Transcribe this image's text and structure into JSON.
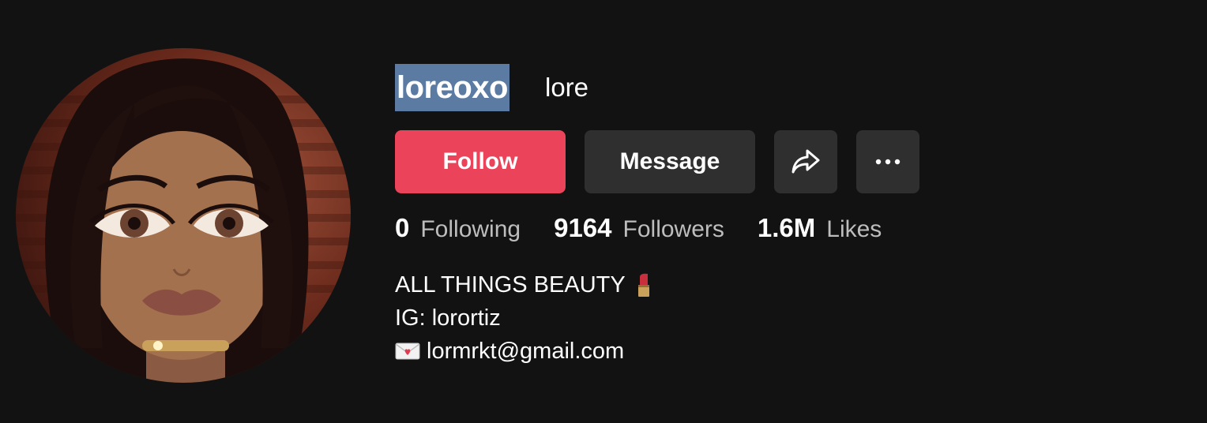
{
  "profile": {
    "username": "loreoxo",
    "nickname": "lore"
  },
  "actions": {
    "follow_label": "Follow",
    "message_label": "Message",
    "share_icon": "share-arrow-icon",
    "more_icon": "more-dots-icon"
  },
  "stats": {
    "following_count": "0",
    "following_label": "Following",
    "followers_count": "9164",
    "followers_label": "Followers",
    "likes_count": "1.6M",
    "likes_label": "Likes"
  },
  "bio": {
    "line1": "ALL THINGS BEAUTY",
    "line1_emoji": "lipstick-icon",
    "line2": "IG: lorortiz",
    "line3_emoji": "love-letter-icon",
    "line3": "lormrkt@gmail.com"
  },
  "colors": {
    "background": "#121212",
    "follow": "#ea435a",
    "secondary_button": "#2f2f2f",
    "selection_highlight": "#5b7ba3"
  }
}
